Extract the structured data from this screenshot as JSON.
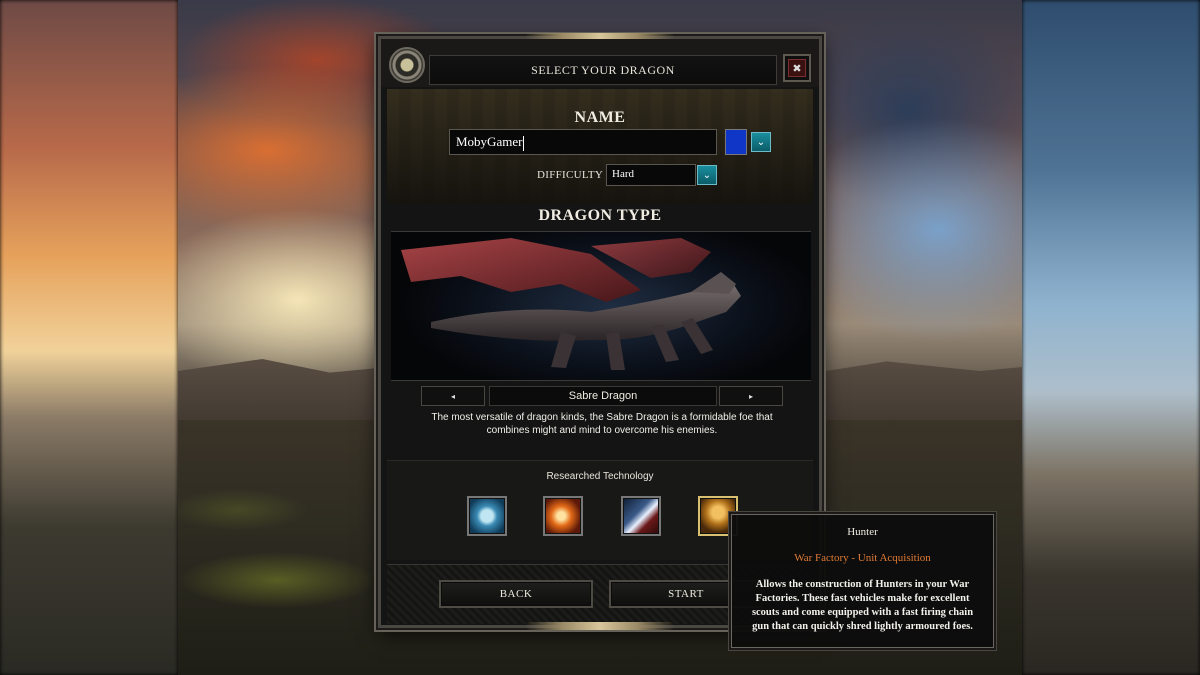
{
  "dialog": {
    "title": "SELECT YOUR DRAGON",
    "close_label": "✖"
  },
  "name_section": {
    "heading": "NAME",
    "input_value": "MobyGamer",
    "color_accent": "#1036c8",
    "difficulty_label": "DIFFICULTY",
    "difficulty_value": "Hard",
    "dropdown_glyph": "⌄"
  },
  "dragon_type": {
    "heading": "DRAGON TYPE",
    "name": "Sabre Dragon",
    "prev_glyph": "◂",
    "next_glyph": "▸",
    "description": "The most versatile of dragon kinds, the Sabre Dragon is a formidable foe that combines might and mind to overcome his enemies."
  },
  "technology": {
    "heading": "Researched Technology",
    "icons": [
      "speed-arrow-icon",
      "fire-burst-icon",
      "strike-arrow-icon",
      "hunter-unit-icon"
    ]
  },
  "buttons": {
    "back": "BACK",
    "start": "START"
  },
  "tooltip": {
    "title": "Hunter",
    "subtitle": "War Factory - Unit Acquisition",
    "body": "Allows the construction of Hunters in your War Factories. These fast vehicles make for excellent scouts and come equipped with a fast firing chain gun that can quickly shred lightly armoured foes."
  }
}
